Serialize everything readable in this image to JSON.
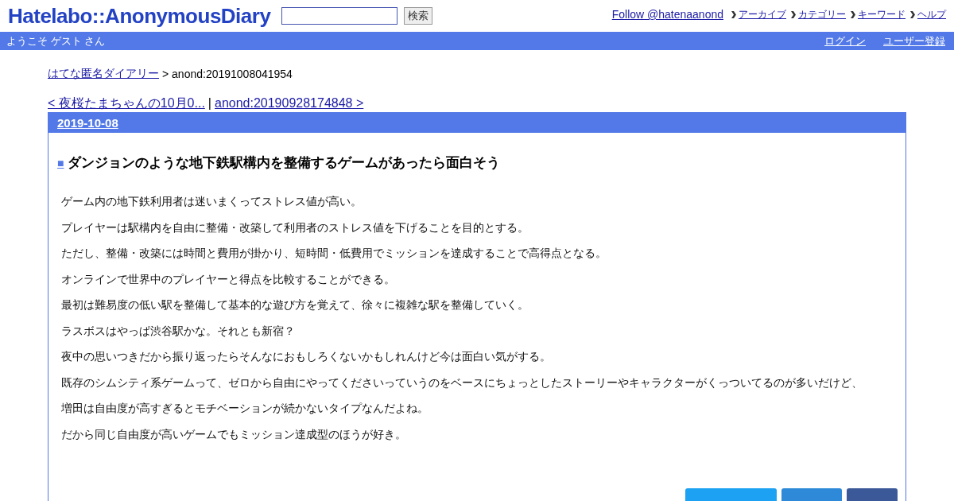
{
  "header": {
    "logo": "Hatelabo::AnonymousDiary",
    "search": {
      "button": "検索"
    },
    "follow_link": "Follow @hatenaanond",
    "nav_links": [
      "アーカイブ",
      "カテゴリー",
      "キーワード",
      "ヘルプ"
    ]
  },
  "user_bar": {
    "greeting": "ようこそ ゲスト さん",
    "links": [
      "ログイン",
      "ユーザー登録"
    ]
  },
  "breadcrumb": {
    "link": "はてな匿名ダイアリー",
    "current": "> anond:20191008041954"
  },
  "pager": {
    "prev": "< 夜桜たまちゃんの10月0...",
    "separator": "|",
    "next": "anond:20190928174848 >"
  },
  "entry": {
    "date": "2019-10-08",
    "title_mark": "■",
    "title": "ダンジョンのような地下鉄駅構内を整備するゲームがあったら面白そう",
    "paragraphs": [
      "ゲーム内の地下鉄利用者は迷いまくってストレス値が高い。",
      "プレイヤーは駅構内を自由に整備・改築して利用者のストレス値を下げることを目的とする。",
      "ただし、整備・改築には時間と費用が掛かり、短時間・低費用でミッションを達成することで高得点となる。",
      "オンラインで世界中のプレイヤーと得点を比較することができる。",
      "最初は難易度の低い駅を整備して基本的な遊び方を覚えて、徐々に複雑な駅を整備していく。",
      "ラスボスはやっぱ渋谷駅かな。それとも新宿？",
      "夜中の思いつきだから振り返ったらそんなにおもしろくないかもしれんけど今は面白い気がする。",
      "既存のシムシティ系ゲームって、ゼロから自由にやってくださいっていうのをベースにちょっとしたストーリーやキャラクターがくっついてるのが多いだけど、",
      "増田は自由度が高すぎるとモチベーションが続かないタイプなんだよね。",
      "だから同じ自由度が高いゲームでもミッション達成型のほうが好き。"
    ],
    "share_buttons": [
      {
        "color": "#1da1f2"
      },
      {
        "color": "#2e8ad8"
      },
      {
        "color": "#3b5998"
      }
    ]
  }
}
